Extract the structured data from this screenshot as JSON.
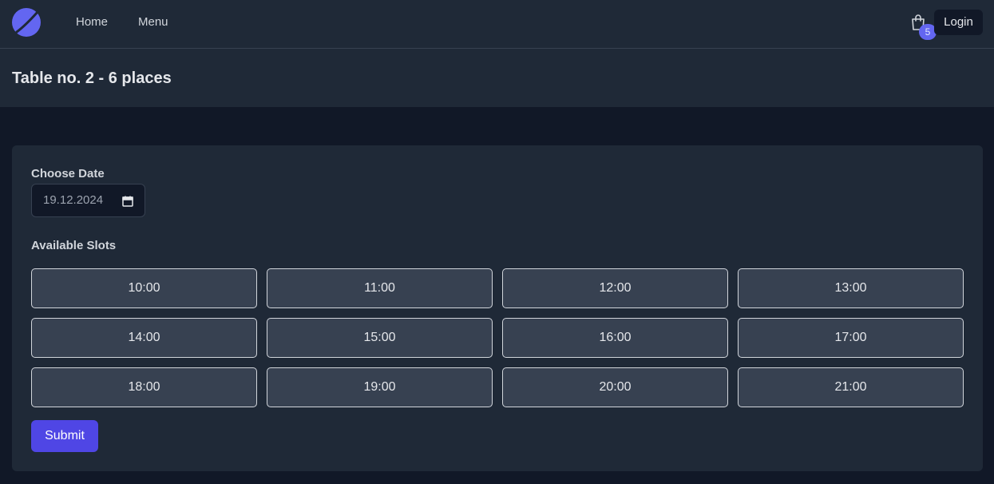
{
  "nav": {
    "links": [
      "Home",
      "Menu"
    ],
    "cart_count": "5",
    "login_label": "Login"
  },
  "header": {
    "title": "Table no. 2 - 6 places"
  },
  "form": {
    "date_label": "Choose Date",
    "date_value": "19.12.2024",
    "slots_label": "Available Slots",
    "slots": [
      "10:00",
      "11:00",
      "12:00",
      "13:00",
      "14:00",
      "15:00",
      "16:00",
      "17:00",
      "18:00",
      "19:00",
      "20:00",
      "21:00"
    ],
    "submit_label": "Submit"
  },
  "colors": {
    "accent": "#4f46e5",
    "badge": "#6366f1",
    "page_bg": "#111827",
    "panel_bg": "#1f2937",
    "slot_bg": "#374151"
  },
  "icons": [
    "logo-icon",
    "shopping-bag-icon",
    "calendar-icon"
  ]
}
